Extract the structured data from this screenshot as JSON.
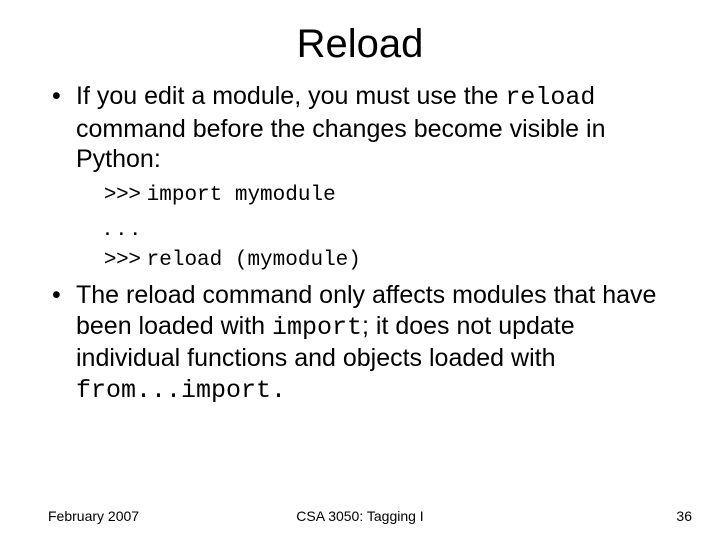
{
  "title": "Reload",
  "bullet1": {
    "pre": "If you edit a module, you must use the ",
    "code": "reload",
    "post": " command before the changes become visible in Python:"
  },
  "code": {
    "prompt1": ">>> ",
    "line1": "import mymodule",
    "ellipsis": ". . .",
    "prompt2": ">>> ",
    "line2": "reload (mymodule)"
  },
  "bullet2": {
    "a": "The reload command only affects modules that have been loaded with ",
    "code1": "import",
    "b": "; it does not update individual functions and objects loaded with ",
    "code2": "from...import.",
    "c": ""
  },
  "footer": {
    "left": "February 2007",
    "center": "CSA 3050: Tagging I",
    "right": "36"
  }
}
